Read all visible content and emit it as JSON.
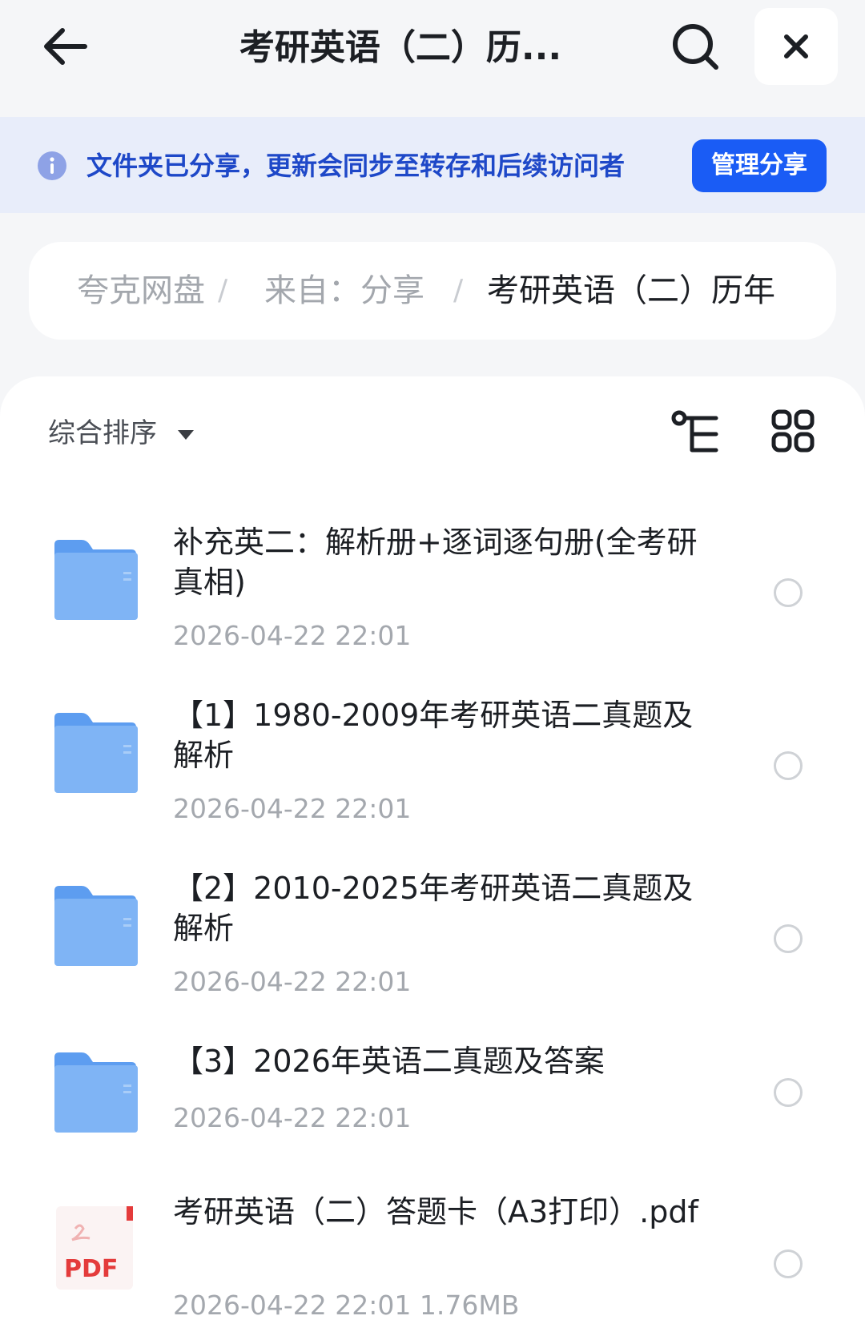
{
  "header": {
    "title": "考研英语（二）历...",
    "back_icon": "arrow-left-icon",
    "search_icon": "search-icon",
    "close_icon": "close-icon"
  },
  "banner": {
    "text": "文件夹已分享，更新会同步至转存和后续访问者",
    "button_label": "管理分享",
    "icon": "info-icon",
    "accent_color": "#1a5cf5"
  },
  "breadcrumb": {
    "items": [
      "夸克网盘",
      "来自：分享",
      "考研英语（二）历年"
    ],
    "separator": "/"
  },
  "toolbar": {
    "sort_label": "综合排序",
    "tree_icon": "tree-view-icon",
    "grid_icon": "grid-view-icon"
  },
  "files": [
    {
      "name": "补充英二：解析册+逐词逐句册(全考研真相)",
      "type": "folder",
      "meta": "2026-04-22 22:01"
    },
    {
      "name": "【1】1980-2009年考研英语二真题及解析",
      "type": "folder",
      "meta": "2026-04-22 22:01"
    },
    {
      "name": "【2】2010-2025年考研英语二真题及解析",
      "type": "folder",
      "meta": "2026-04-22 22:01"
    },
    {
      "name": "【3】2026年英语二真题及答案",
      "type": "folder",
      "meta": "2026-04-22 22:01"
    },
    {
      "name": "考研英语（二）答题卡（A3打印）.pdf",
      "type": "pdf",
      "pdf_label": "PDF",
      "meta": "2026-04-22 22:01  1.76MB"
    }
  ]
}
